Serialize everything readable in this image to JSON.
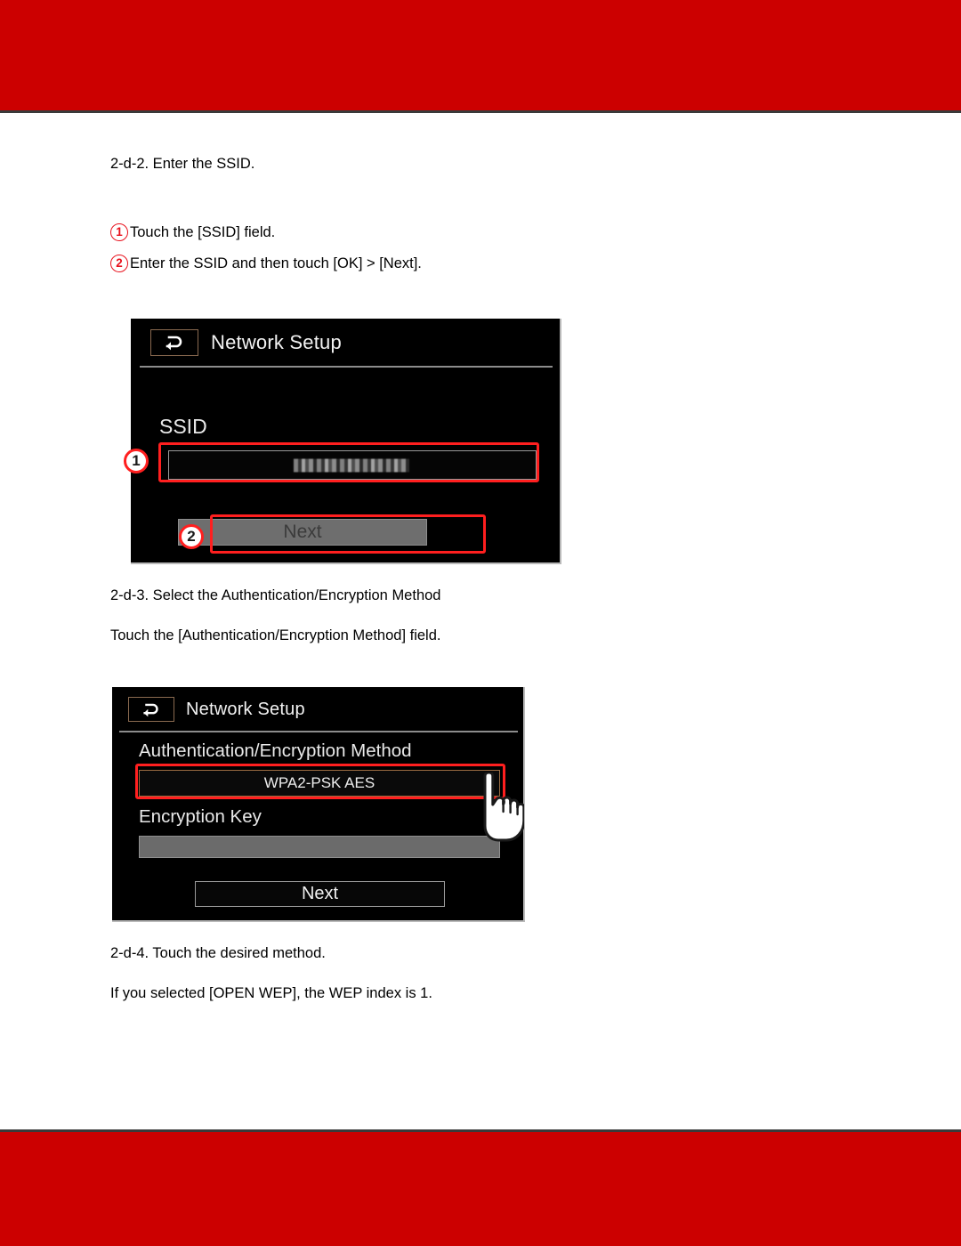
{
  "page": {
    "background_color": "#ffffff",
    "band_color": "#cc0000",
    "band_rule_color": "#3a3a3a"
  },
  "annotation": {
    "marker_color": "#ff1f1f",
    "one": "1",
    "two": "2"
  },
  "content": {
    "step_2d2_heading": "2-d-2. Enter the SSID.",
    "step_2d2_item1": "Touch the [SSID] field.",
    "step_2d2_item2": "Enter the SSID and then touch [OK] > [Next].",
    "step_2d3_heading": "2-d-3. Select the Authentication/Encryption Method",
    "step_2d3_body": "Touch the [Authentication/Encryption Method] field.",
    "step_2d4_heading": "2-d-4. Touch the desired method.",
    "step_2d4_body": "If you selected [OPEN WEP], the WEP index is 1."
  },
  "device_ssid": {
    "back_icon": "back-arrow-icon",
    "title": "Network Setup",
    "ssid_label": "SSID",
    "ssid_value": "",
    "next_label": "Next",
    "next_enabled": false
  },
  "device_auth": {
    "back_icon": "back-arrow-icon",
    "title": "Network Setup",
    "auth_label": "Authentication/Encryption Method",
    "auth_value": "WPA2-PSK AES",
    "enc_key_label": "Encryption Key",
    "enc_key_value": "",
    "next_label": "Next",
    "next_enabled": true,
    "cursor_icon": "pointing-hand-icon"
  }
}
